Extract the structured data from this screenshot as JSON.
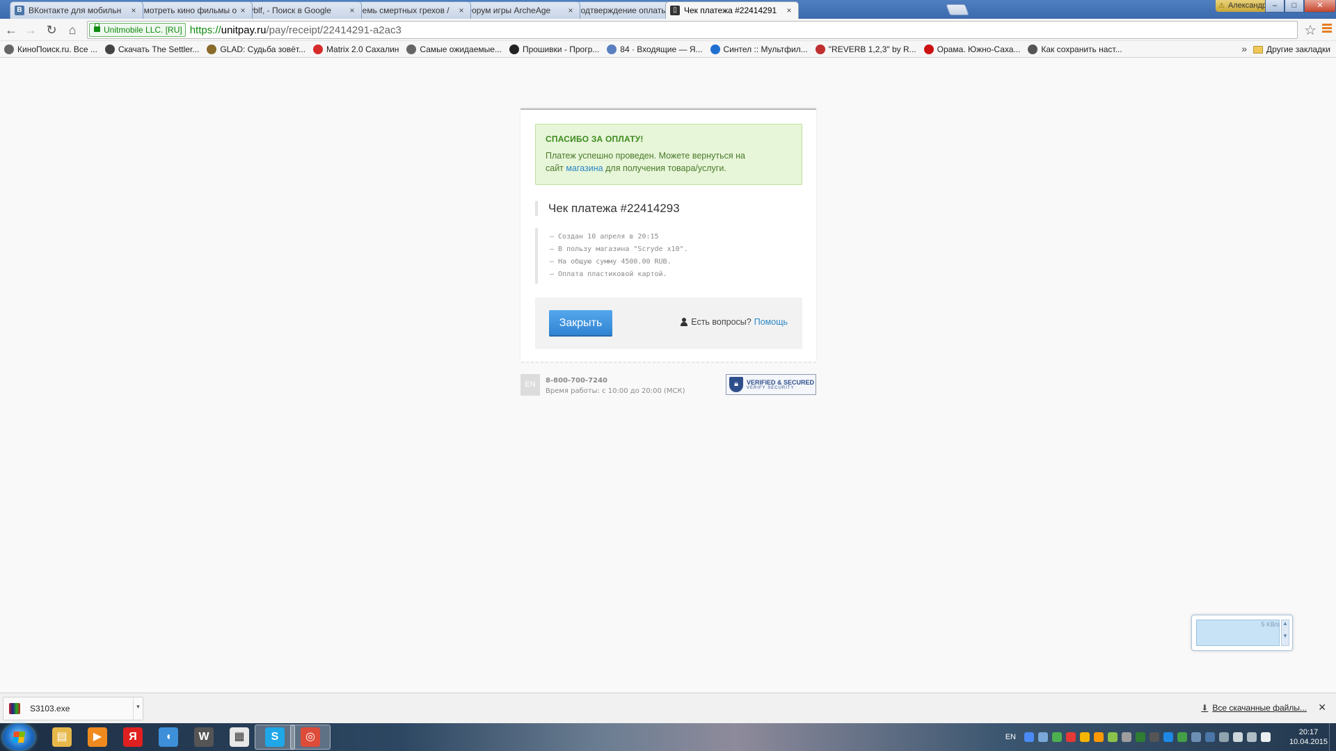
{
  "browser": {
    "tabs": [
      {
        "title": "ВКонтакте для мобильн",
        "icon": "vk-icon",
        "color": "#4a76a8",
        "glyph": "B"
      },
      {
        "title": "Смотреть кино фильмы о",
        "icon": "cinema-icon",
        "color": "#333333",
        "glyph": "◉"
      },
      {
        "title": "fyblf, - Поиск в Google",
        "icon": "google-icon",
        "color": "#4a8af4",
        "glyph": "g"
      },
      {
        "title": "Семь смертных грехов /",
        "icon": "anime-icon",
        "color": "#2a7a9a",
        "glyph": "▣"
      },
      {
        "title": "Форум игры ArcheAge",
        "icon": "archeage-icon",
        "color": "#3d5a3d",
        "glyph": "A"
      },
      {
        "title": "Подтверждение оплаты",
        "icon": "payment-icon",
        "color": "#555555",
        "glyph": "L"
      },
      {
        "title": "Чек платежа #22414291",
        "icon": "receipt-icon",
        "color": "#333333",
        "glyph": "▯",
        "active": true
      }
    ],
    "user_name": "Александр",
    "window_controls": {
      "minimize": "‒",
      "maximize": "□",
      "close": "✕"
    },
    "toolbar": {
      "ev_name": "Unitmobile LLC. [RU]",
      "url_scheme": "https://",
      "url_host": "unitpay.ru",
      "url_path": "/pay/receipt/22414291-a2ac3"
    },
    "bookmarks": [
      {
        "label": "КиноПоиск.ru. Все ...",
        "color": "#666666"
      },
      {
        "label": "Скачать The Settler...",
        "color": "#444444"
      },
      {
        "label": "GLAD: Судьба зовёт...",
        "color": "#8a6b2b"
      },
      {
        "label": "Matrix 2.0 Сахалин",
        "color": "#d62b2b"
      },
      {
        "label": "Самые ожидаемые...",
        "color": "#666666"
      },
      {
        "label": "Прошивки - Прогр...",
        "color": "#222222"
      },
      {
        "label": "84 · Входящие — Я...",
        "color": "#5a7fc0"
      },
      {
        "label": "Синтел :: Мультфил...",
        "color": "#1f6fd0"
      },
      {
        "label": "\"REVERB 1,2,3\" by R...",
        "color": "#c03030"
      },
      {
        "label": "Орама. Южно-Саха...",
        "color": "#cc1111"
      },
      {
        "label": "Как сохранить наст...",
        "color": "#555555"
      }
    ],
    "bookmarks_more": "»",
    "other_bookmarks": "Другие закладки"
  },
  "receipt": {
    "success_title": "СПАСИБО ЗА ОПЛАТУ!",
    "success_text_1": "Платеж успешно проведен. Можете вернуться на",
    "success_text_2": "сайт",
    "success_link": "магазина",
    "success_text_3": "для получения товара/услуги.",
    "title": "Чек платежа #22414293",
    "details": [
      "— Создан 10 апреля в 20:15",
      "— В пользу магазина \"Scryde x10\".",
      "— На общую сумму 4500.00 RUB.",
      "— Оплата пластиковой картой."
    ],
    "close_button": "Закрыть",
    "help_question": "Есть вопросы?",
    "help_link": "Помощь",
    "lang_button": "EN",
    "phone": "8-800-700-7240",
    "hours": "Время работы: с 10:00 до 20:00 (МСК)",
    "verified_title": "VERIFIED & SECURED",
    "verified_sub": "VERIFY SECURITY"
  },
  "net_widget": {
    "rate": "5 KB/s"
  },
  "downloads": {
    "file_name": "S3103.exe",
    "show_all": "Все скачанные файлы...",
    "close": "✕"
  },
  "taskbar": {
    "apps": [
      {
        "name": "explorer-icon",
        "color": "#e6b84a",
        "glyph": "▤"
      },
      {
        "name": "media-player-icon",
        "color": "#f08a1e",
        "glyph": "▶"
      },
      {
        "name": "yandex-icon",
        "color": "#e02020",
        "glyph": "Я"
      },
      {
        "name": "sound-app-icon",
        "color": "#3c8fd8",
        "glyph": "◖"
      },
      {
        "name": "world-of-tanks-icon",
        "color": "#555555",
        "glyph": "W"
      },
      {
        "name": "document-app-icon",
        "color": "#e8e8e8",
        "glyph": "▦"
      },
      {
        "name": "skype-icon",
        "color": "#1fa7e8",
        "glyph": "S",
        "active": true
      },
      {
        "name": "chrome-icon",
        "color": "#dd4b39",
        "glyph": "◎",
        "active": true
      }
    ],
    "language": "EN",
    "time": "20:17",
    "date": "10.04.2015"
  }
}
